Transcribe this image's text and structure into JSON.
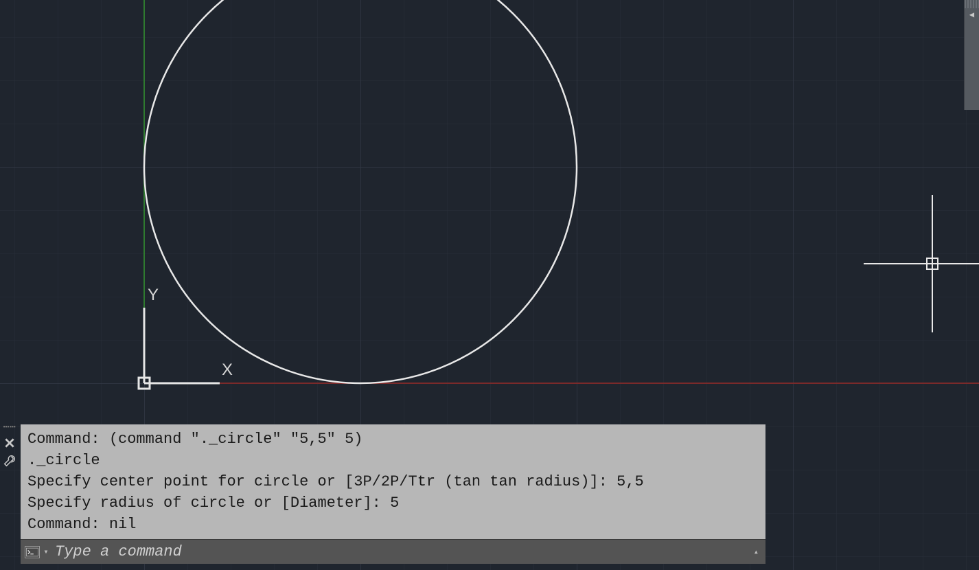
{
  "axes": {
    "y_label": "Y",
    "x_label": "X"
  },
  "command": {
    "history": [
      "Command: (command \"._circle\" \"5,5\" 5)",
      "._circle",
      "Specify center point for circle or [3P/2P/Ttr (tan tan radius)]: 5,5",
      "Specify radius of circle or [Diameter]: 5",
      "Command: nil"
    ],
    "placeholder": "Type a command"
  }
}
